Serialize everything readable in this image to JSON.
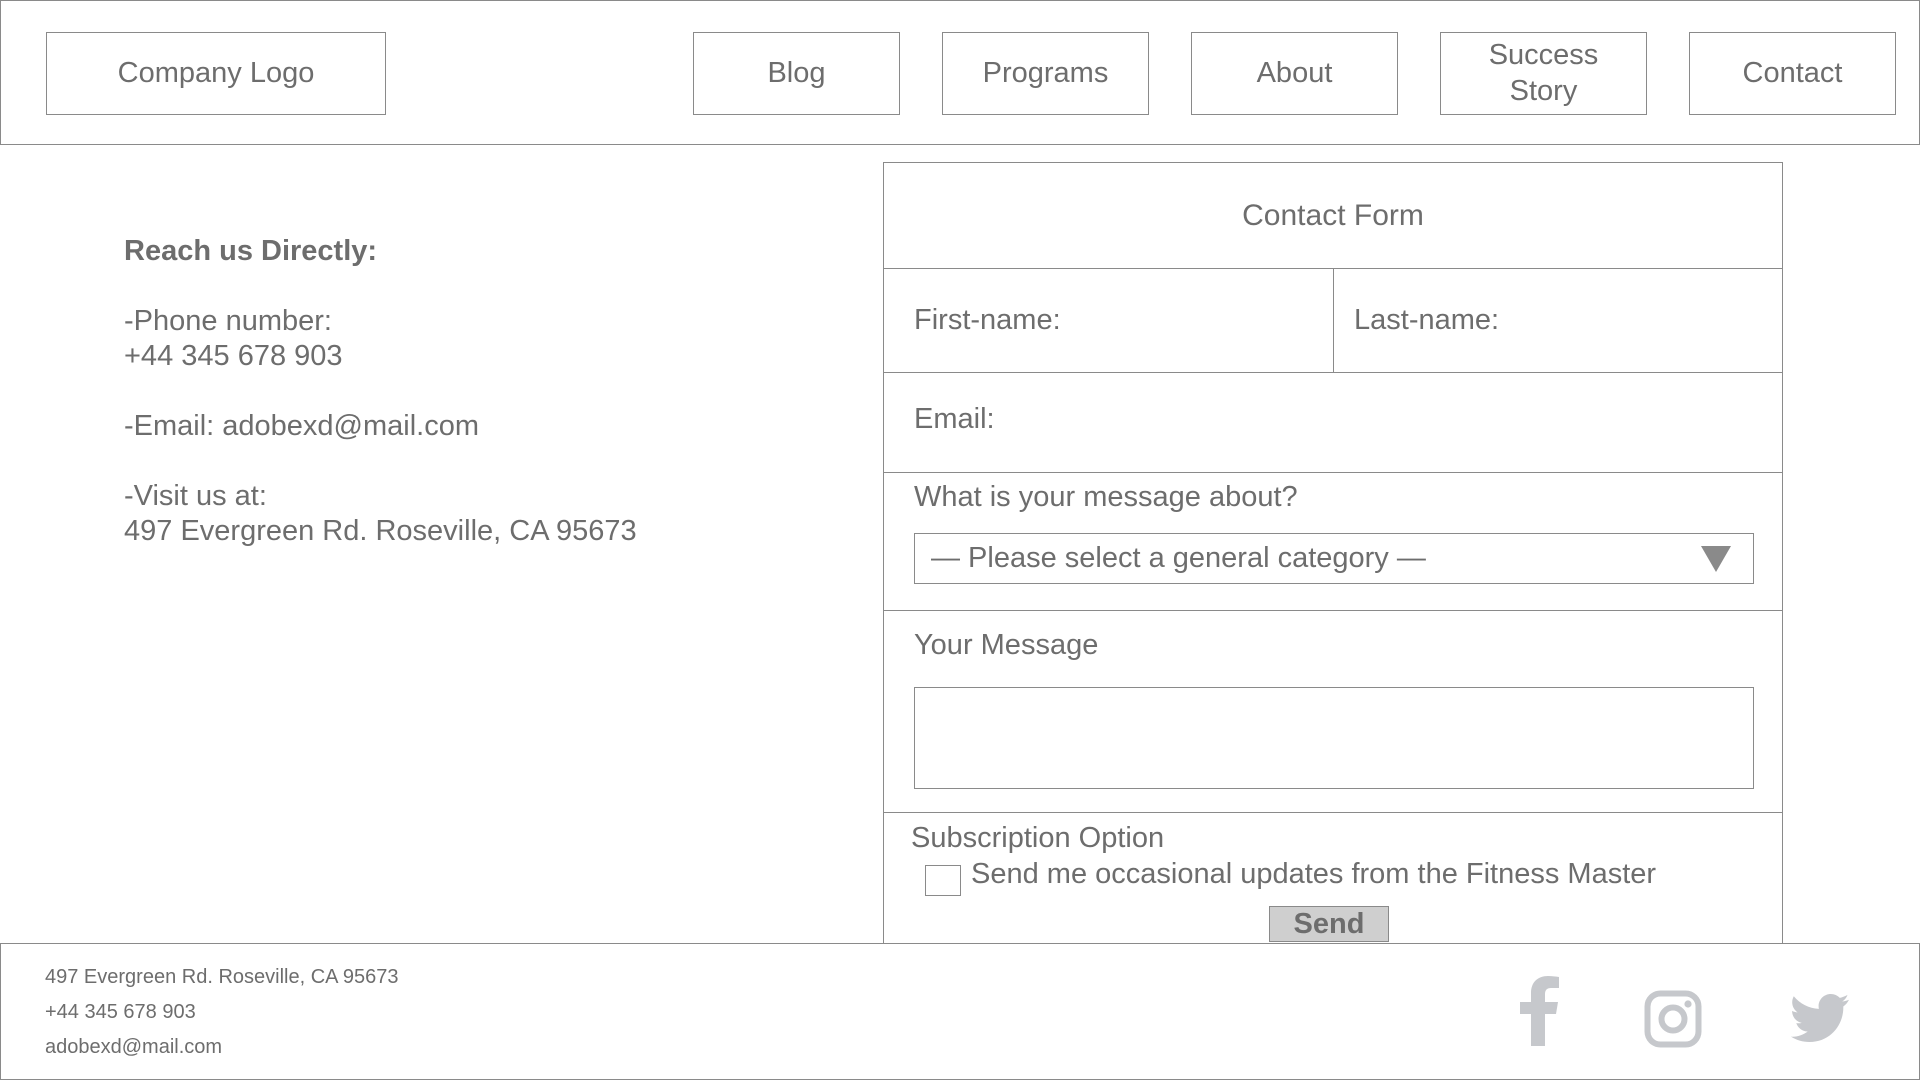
{
  "header": {
    "logo": "Company Logo",
    "nav": {
      "blog": "Blog",
      "programs": "Programs",
      "about": "About",
      "success_story": "Success Story",
      "contact": "Contact"
    }
  },
  "contact_info": {
    "heading": "Reach us Directly:",
    "phone_label": "-Phone number:",
    "phone": "+44 345 678 903",
    "email_line": "-Email: adobexd@mail.com",
    "visit_label": "-Visit us at:",
    "address": "497 Evergreen Rd. Roseville, CA 95673"
  },
  "form": {
    "title": "Contact Form",
    "first_name_label": "First-name:",
    "last_name_label": "Last-name:",
    "email_label": "Email:",
    "topic_label": "What is your message about?",
    "topic_selected": "— Please select a general category —",
    "message_label": "Your Message",
    "message_value": "",
    "subscription_label": "Subscription Option",
    "subscription_checkbox_label": "Send me occasional updates from the Fitness Master",
    "subscription_checked": false,
    "send_label": "Send"
  },
  "footer": {
    "address": "497 Evergreen Rd. Roseville, CA 95673",
    "phone": "+44 345 678 903",
    "email": "adobexd@mail.com"
  },
  "icons": {
    "facebook": "facebook-icon",
    "instagram": "instagram-icon",
    "twitter": "twitter-icon"
  },
  "colors": {
    "text": "#6d6d6d",
    "border": "#8a8a8a",
    "button_bg": "#cfcfcf",
    "social_icon": "#c6c8cc"
  }
}
